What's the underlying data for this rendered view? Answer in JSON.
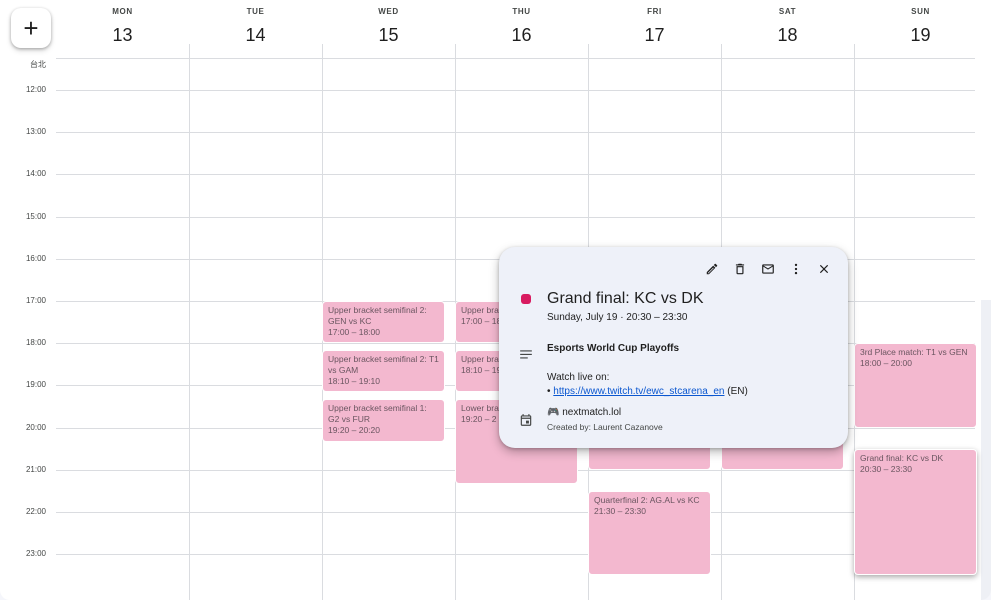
{
  "timezone_label": "台北",
  "create_button_label": "+",
  "days": [
    {
      "name": "MON",
      "num": "13"
    },
    {
      "name": "TUE",
      "num": "14"
    },
    {
      "name": "WED",
      "num": "15"
    },
    {
      "name": "THU",
      "num": "16"
    },
    {
      "name": "FRI",
      "num": "17"
    },
    {
      "name": "SAT",
      "num": "18"
    },
    {
      "name": "SUN",
      "num": "19"
    }
  ],
  "hours": [
    "12:00",
    "13:00",
    "14:00",
    "15:00",
    "16:00",
    "17:00",
    "18:00",
    "19:00",
    "20:00",
    "21:00",
    "22:00",
    "23:00"
  ],
  "events": [
    {
      "day": 2,
      "start": "17:00",
      "end": "18:00",
      "title": "Upper bracket semifinal 2: GEN vs KC",
      "time": "17:00 – 18:00"
    },
    {
      "day": 2,
      "start": "18:10",
      "end": "19:10",
      "title": "Upper bracket semifinal 2: T1 vs GAM",
      "time": "18:10 – 19:10"
    },
    {
      "day": 2,
      "start": "19:20",
      "end": "20:20",
      "title": "Upper bracket semifinal 1: G2 vs FUR",
      "time": "19:20 – 20:20"
    },
    {
      "day": 3,
      "start": "17:00",
      "end": "18:00",
      "title": "Upper bra T1",
      "time": "17:00 – 18"
    },
    {
      "day": 3,
      "start": "18:10",
      "end": "19:10",
      "title": "Upper bra AG.AL",
      "time": "18:10 – 19"
    },
    {
      "day": 3,
      "start": "19:20",
      "end": "21:20",
      "title": "Lower bra TBD",
      "time": "19:20 – 2"
    },
    {
      "day": 4,
      "start": "20:00",
      "end": "21:00",
      "title": "",
      "time": ""
    },
    {
      "day": 5,
      "start": "20:00",
      "end": "21:00",
      "title": "",
      "time": ""
    },
    {
      "day": 4,
      "start": "21:30",
      "end": "23:30",
      "title": "Quarterfinal 2: AG.AL vs KC",
      "time": "21:30 – 23:30"
    },
    {
      "day": 6,
      "start": "18:00",
      "end": "20:00",
      "title": "3rd Place match: T1 vs GEN",
      "time": "18:00 – 20:00"
    },
    {
      "day": 6,
      "start": "20:30",
      "end": "23:30",
      "title": "Grand final: KC vs DK",
      "time": "20:30 – 23:30",
      "selected": true
    }
  ],
  "popup": {
    "title": "Grand final: KC vs DK",
    "date": "Sunday, July 19  ·  20:30 – 23:30",
    "description_title": "Esports World Cup Playoffs",
    "watch_label": "Watch live on:",
    "bullet": "• ",
    "link_text": "https://www.twitch.tv/ewc_stcarena_en",
    "link_suffix": " (EN)",
    "calendar_name": "🎮 nextmatch.lol",
    "creator": "Created by: Laurent Cazanove",
    "event_color": "#d81b60",
    "actions": [
      "pencil-icon",
      "trash-icon",
      "mail-icon",
      "more-vert-icon",
      "close-icon"
    ]
  },
  "colors": {
    "event_bg": "#f3b8cf",
    "event_text": "#6a5560",
    "link": "#0b57d0"
  }
}
